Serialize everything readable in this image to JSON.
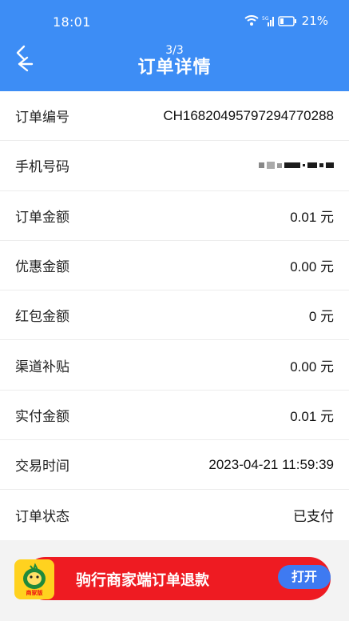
{
  "status_bar": {
    "time": "18:01",
    "battery": "21%"
  },
  "header": {
    "title": "订单详情",
    "page_counter": "3/3"
  },
  "order": {
    "rows": [
      {
        "label": "订单编号",
        "value": "CH16820495797294770288"
      },
      {
        "label": "手机号码",
        "value": ""
      },
      {
        "label": "订单金额",
        "value": "0.01 元"
      },
      {
        "label": "优惠金额",
        "value": "0.00 元"
      },
      {
        "label": "红包金额",
        "value": "0 元"
      },
      {
        "label": "渠道补贴",
        "value": "0.00 元"
      },
      {
        "label": "实付金额",
        "value": "0.01 元"
      },
      {
        "label": "交易时间",
        "value": "2023-04-21 11:59:39"
      },
      {
        "label": "订单状态",
        "value": "已支付"
      }
    ]
  },
  "ad": {
    "app_name": "驹行商家端",
    "action": "订单退款",
    "open_label": "打开",
    "logo_text": "商家版"
  },
  "colors": {
    "header": "#3d8df5",
    "ad_banner": "#ee1b22",
    "open_button": "#3e7af1",
    "logo_bg": "#ffd21f"
  }
}
